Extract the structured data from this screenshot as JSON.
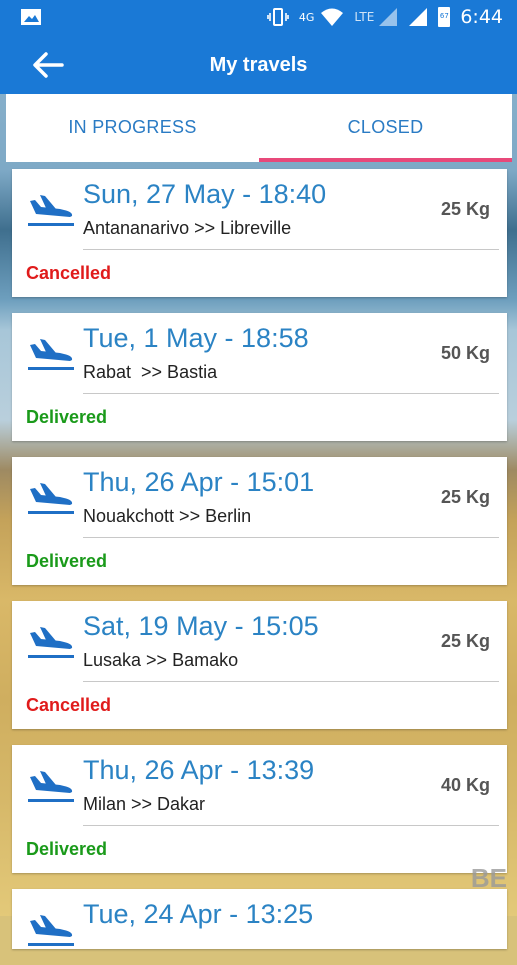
{
  "status_bar": {
    "network": "4G",
    "lte": "LTE",
    "battery": "67",
    "time": "6:44",
    "icons": [
      "image-icon",
      "vibrate-icon",
      "wifi-icon",
      "signal-icon",
      "battery-icon"
    ]
  },
  "app_bar": {
    "title": "My travels",
    "back_icon": "arrow-left-icon"
  },
  "tabs": [
    {
      "label": "IN PROGRESS",
      "active": false
    },
    {
      "label": "CLOSED",
      "active": true
    }
  ],
  "travels": [
    {
      "date": "Sun, 27 May - 18:40",
      "route": "Antananarivo >> Libreville",
      "weight": "25 Kg",
      "status": "Cancelled"
    },
    {
      "date": "Tue, 1 May - 18:58",
      "route": "Rabat  >> Bastia",
      "weight": "50 Kg",
      "status": "Delivered"
    },
    {
      "date": "Thu, 26 Apr - 15:01",
      "route": "Nouakchott >> Berlin",
      "weight": "25 Kg",
      "status": "Delivered"
    },
    {
      "date": "Sat, 19 May - 15:05",
      "route": "Lusaka >> Bamako",
      "weight": "25 Kg",
      "status": "Cancelled"
    },
    {
      "date": "Thu, 26 Apr - 13:39",
      "route": "Milan >> Dakar",
      "weight": "40 Kg",
      "status": "Delivered"
    },
    {
      "date": "Tue, 24 Apr - 13:25",
      "route": "",
      "weight": "",
      "status": ""
    }
  ],
  "colors": {
    "primary": "#1a79d6",
    "accent": "#e8497a",
    "date_text": "#2b83c4",
    "cancelled": "#e01b1b",
    "delivered": "#1a9a1a"
  },
  "watermark": "BE"
}
